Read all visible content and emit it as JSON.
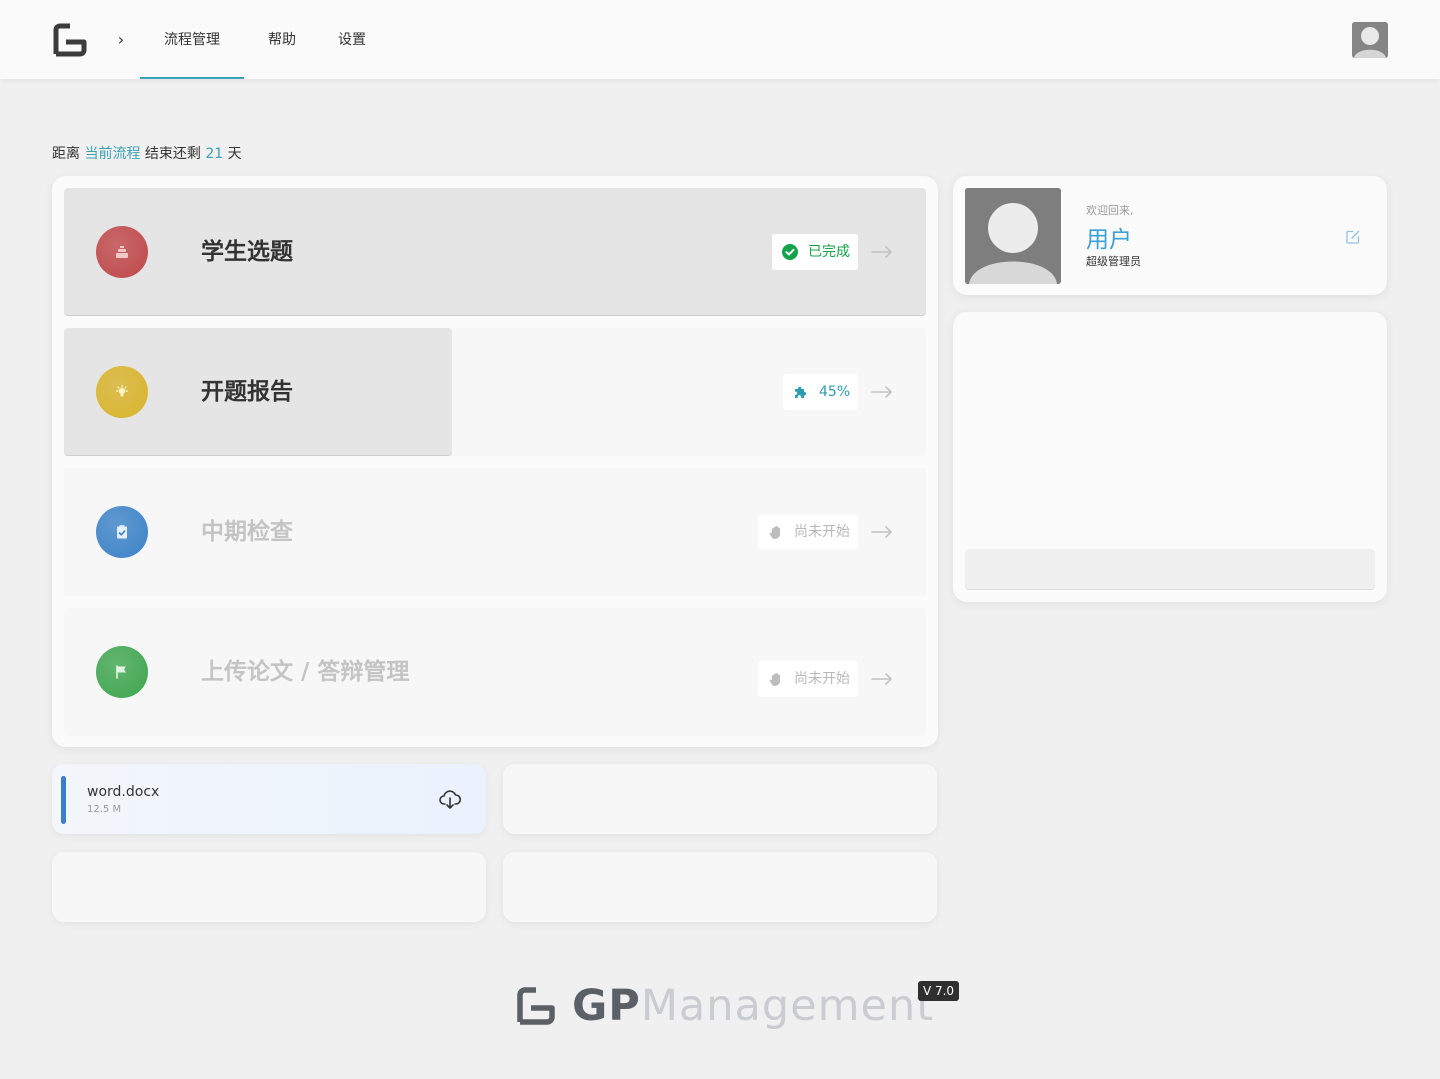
{
  "header": {
    "nav": [
      {
        "label": "流程管理",
        "active": true
      },
      {
        "label": "帮助",
        "active": false
      },
      {
        "label": "设置",
        "active": false
      }
    ],
    "crumb_glyph": "›"
  },
  "countdown": {
    "prefix": "距离",
    "link": "当前流程",
    "middle": "结束还剩",
    "days": "21",
    "suffix": "天"
  },
  "steps": [
    {
      "title": "学生选题",
      "status": "已完成",
      "status_icon": "check-circle-icon",
      "status_color": "#13a44a",
      "progress": 1.0,
      "circle_color": "#c0484a",
      "icon": "stack-icon"
    },
    {
      "title": "开题报告",
      "status": "45%",
      "status_icon": "puzzle-icon",
      "status_color": "#2c9db0",
      "progress": 0.45,
      "circle_color": "#d9b42c",
      "icon": "lightbulb-icon"
    },
    {
      "title": "中期检查",
      "status": "尚未开始",
      "status_icon": "hand-icon",
      "status_color": "#b8b8b8",
      "progress": 0,
      "circle_color": "#3b82c7",
      "icon": "clipboard-check-icon"
    },
    {
      "title": "上传论文 / 答辩管理",
      "status": "尚未开始",
      "status_icon": "hand-icon",
      "status_color": "#b8b8b8",
      "progress": 0,
      "circle_color": "#3ea54e",
      "icon": "flag-icon"
    }
  ],
  "user": {
    "welcome": "欢迎回来,",
    "name": "用户",
    "role": "超级管理员"
  },
  "files": [
    {
      "name": "word.docx",
      "size": "12.5 M"
    }
  ],
  "footer": {
    "brand_gp": "GP",
    "brand_rest": "Management",
    "version": "V 7.0"
  },
  "colors": {
    "accent": "#3aa3b6",
    "user_name": "#3aa0d8"
  }
}
